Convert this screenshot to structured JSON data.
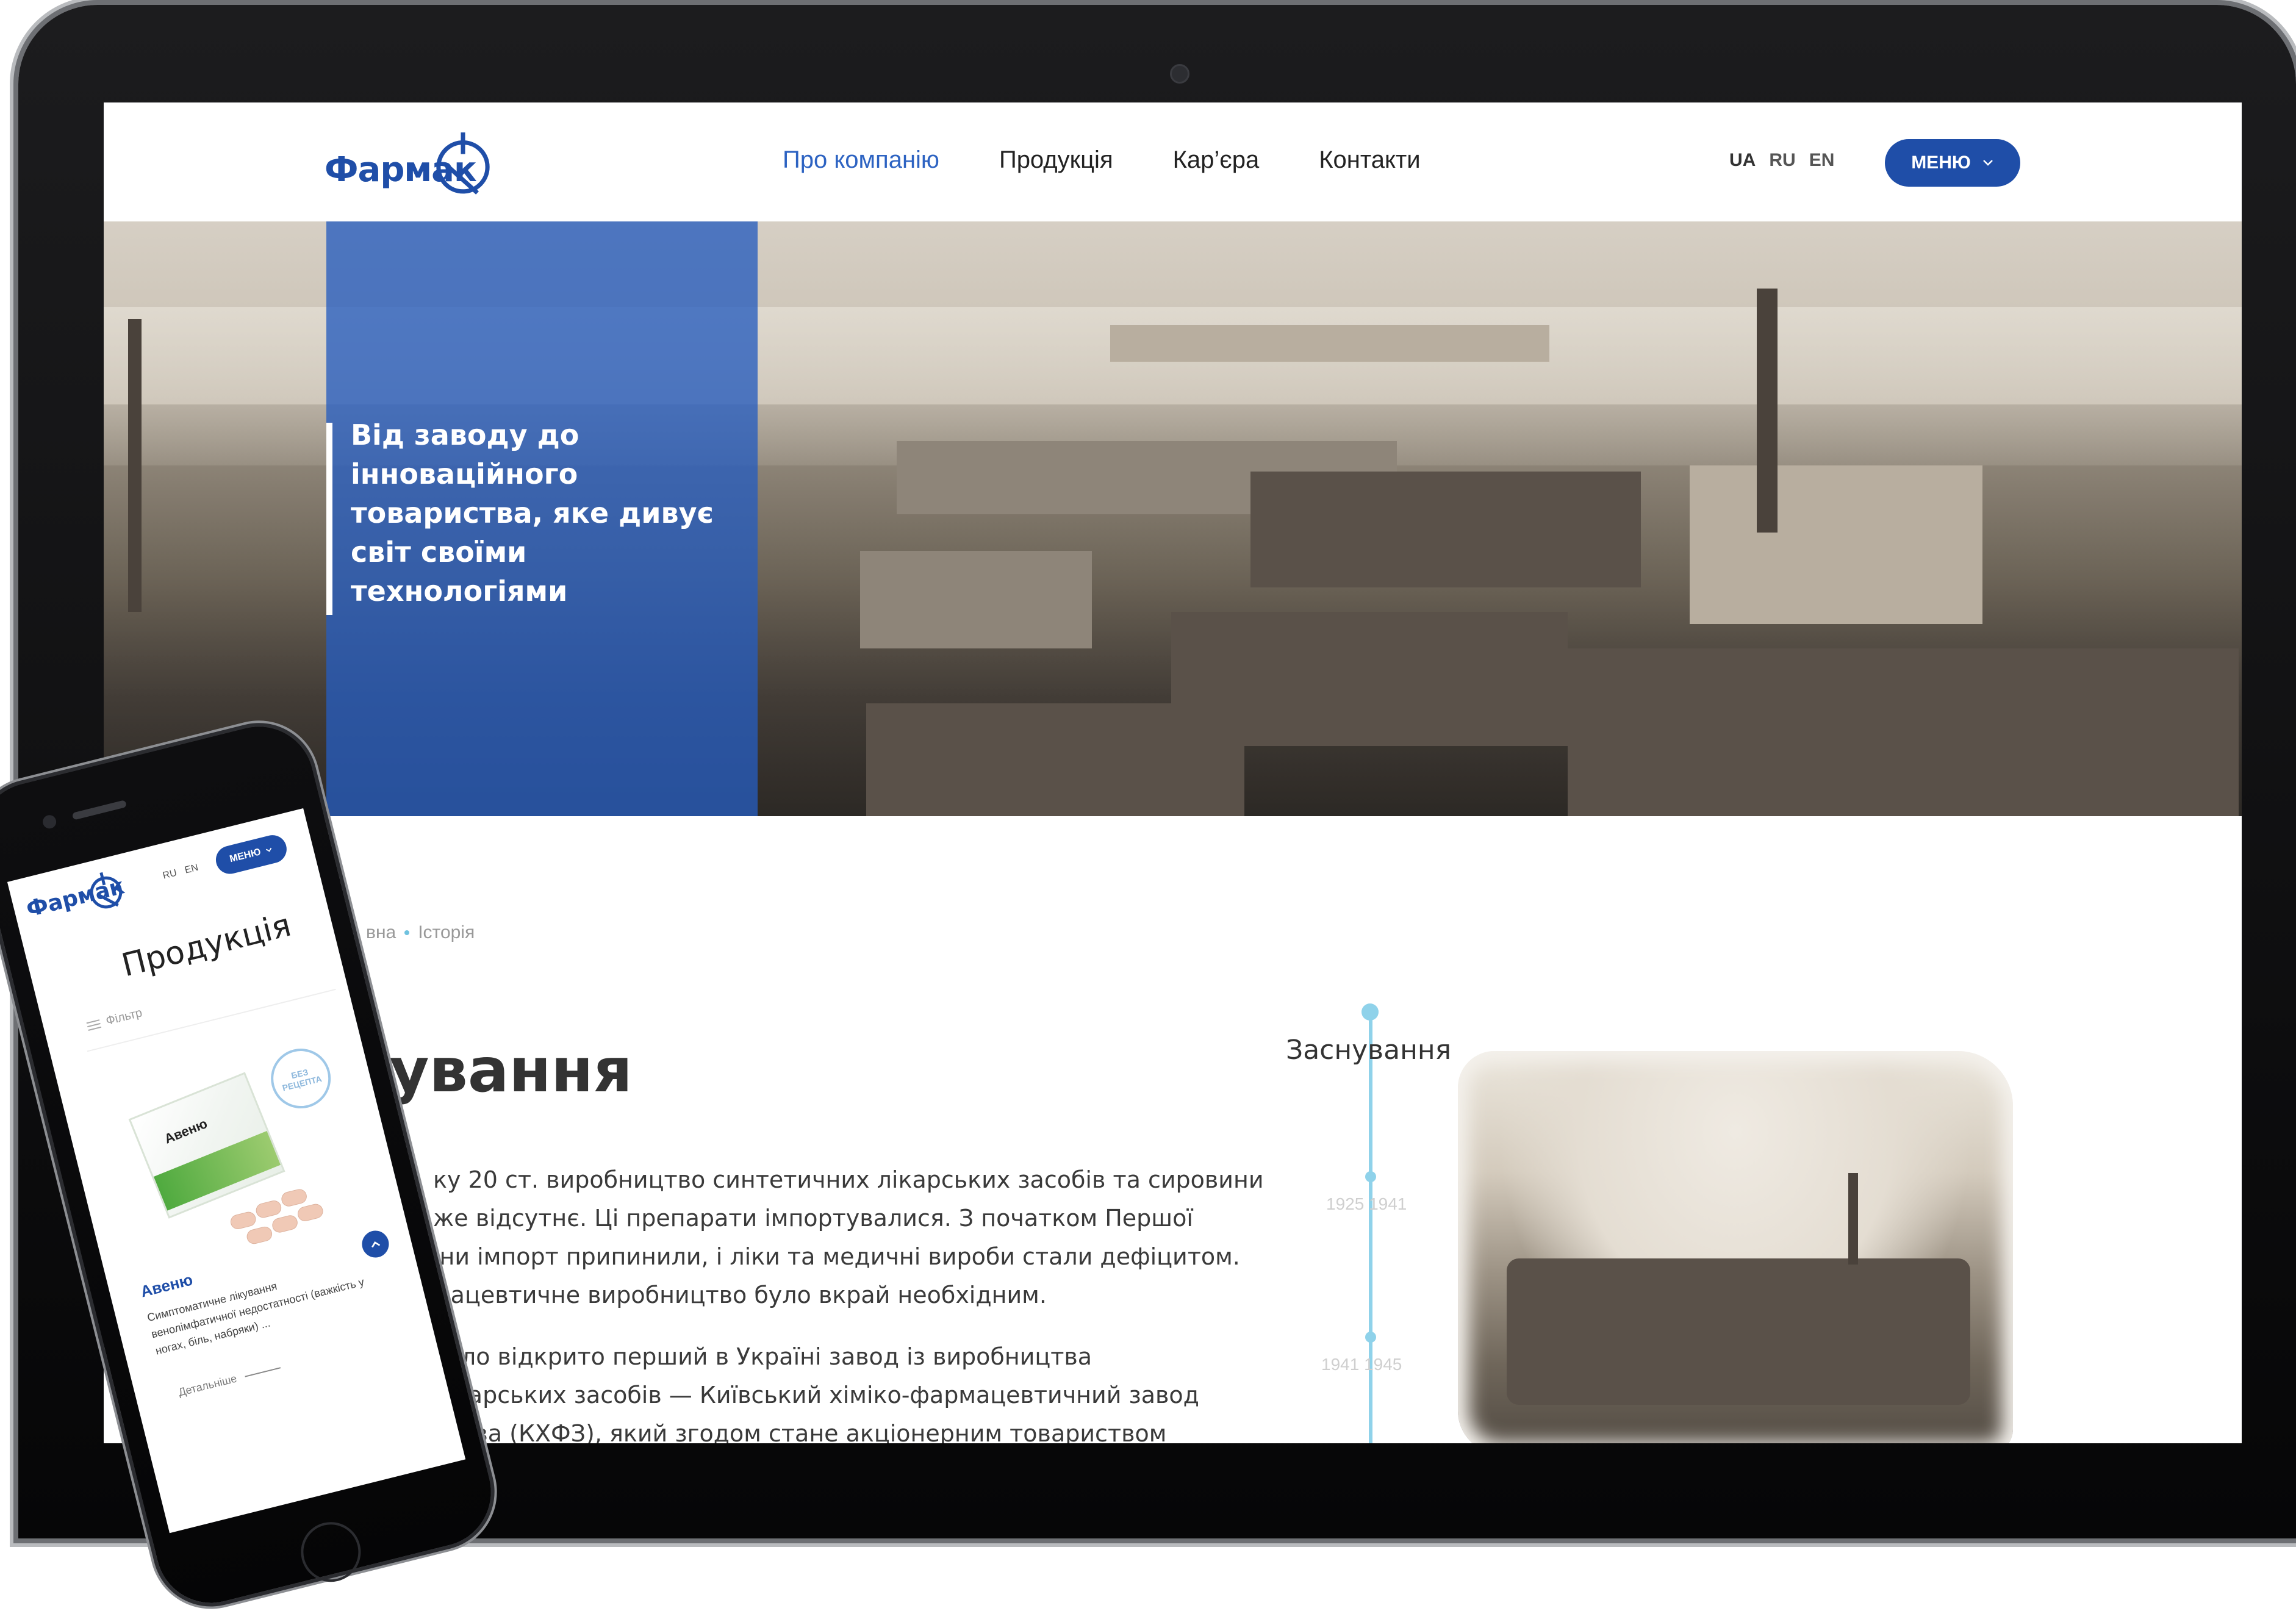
{
  "header": {
    "logo": "Фармак",
    "nav": [
      "Про компанію",
      "Продукція",
      "Кар’єра",
      "Контакти"
    ],
    "active_nav": 0,
    "langs": [
      "UA",
      "RU",
      "EN"
    ],
    "menu_label": "МЕНЮ"
  },
  "hero": {
    "text": "Від заводу до інноваційного товариства, яке дивує світ своїми технологіями"
  },
  "content": {
    "breadcrumb_home": "вна",
    "breadcrumb_current": "Історія",
    "title": "снування",
    "paragraph1": "ку 20 ст. виробництво синтетичних лікарських засобів та сировини\nже відсутнє. Ці препарати імпортувалися. З початком Першої\nіни імпорт припинили, і ліки та медичні вироби стали дефіцитом.\nмацевтичне виробництво було вкрай необхідним.",
    "paragraph2": "було відкрито перший в Україні завод із виробництва\nлікарських засобів — Київський хіміко-фармацевтичний завод\nосова (КХФЗ), який згодом стане акціонерним товариством"
  },
  "timeline": {
    "title": "Заснування",
    "period1": "1925  1941",
    "period2": "1941   1945"
  },
  "phone": {
    "logo": "Фармак",
    "langs": [
      "RU",
      "EN"
    ],
    "menu_label": "МЕНЮ",
    "title": "Продукція",
    "filter_label": "Фільтр",
    "badge": "БЕЗ РЕЦЕПТА",
    "box_label": "Авеню",
    "product_name": "Авеню",
    "product_desc": "Симптоматичне лікування венолімфатичної недостатності (важкість у ногах, біль, набряки) ...",
    "more_label": "Детальніше"
  },
  "colors": {
    "brand_blue": "#1f4ea8",
    "nav_active": "#2d63c2",
    "timeline": "#8fd2ea"
  }
}
